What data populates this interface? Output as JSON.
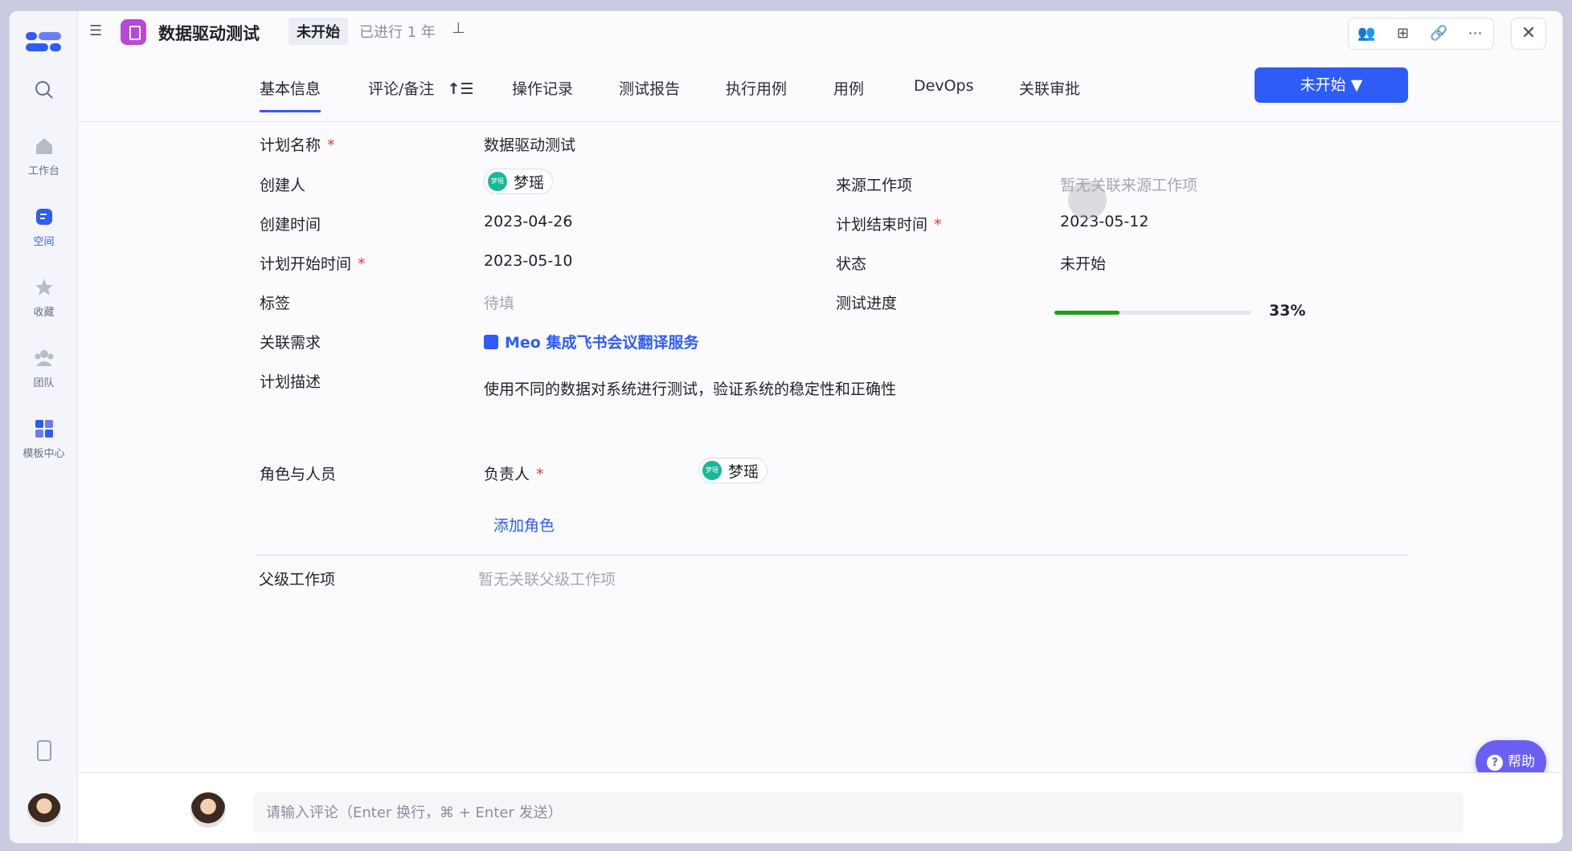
{
  "header": {
    "expand_icon": "sidebar-expand-icon",
    "title": "数据驱动测试",
    "status_badge": "未开始",
    "elapsed": "已进行 1 年",
    "pin_icon": "pin-icon",
    "actions": [
      "members-icon",
      "bookmark-icon",
      "link-icon",
      "more-icon"
    ],
    "close_icon": "close-icon"
  },
  "sidebar": {
    "items": [
      {
        "label": "",
        "icon": "search-icon"
      },
      {
        "label": "工作台",
        "icon": "home-icon"
      },
      {
        "label": "空间",
        "icon": "space-icon",
        "active": true
      },
      {
        "label": "收藏",
        "icon": "star-icon"
      },
      {
        "label": "团队",
        "icon": "team-icon"
      },
      {
        "label": "模板中心",
        "icon": "template-icon"
      }
    ]
  },
  "tabs": [
    {
      "label": "基本信息",
      "active": true
    },
    {
      "label": "评论/备注"
    },
    {
      "label": "操作记录"
    },
    {
      "label": "测试报告"
    },
    {
      "label": "执行用例"
    },
    {
      "label": "用例"
    },
    {
      "label": "DevOps"
    },
    {
      "label": "关联审批"
    }
  ],
  "status_button": {
    "label": "未开始 ▼"
  },
  "fields": {
    "plan_name": {
      "label": "计划名称",
      "value": "数据驱动测试"
    },
    "creator": {
      "label": "创建人",
      "value": "梦瑶",
      "avatar_text": "梦瑶"
    },
    "source_item": {
      "label": "来源工作项",
      "value": "暂无关联来源工作项"
    },
    "created_at": {
      "label": "创建时间",
      "value": "2023-04-26"
    },
    "plan_end": {
      "label": "计划结束时间",
      "value": "2023-05-12"
    },
    "plan_start": {
      "label": "计划开始时间",
      "value": "2023-05-10"
    },
    "status": {
      "label": "状态",
      "value": "未开始"
    },
    "tags": {
      "label": "标签",
      "value": "待填"
    },
    "progress": {
      "label": "测试进度",
      "value": "33%",
      "fraction": 0.33,
      "color": "#16a316"
    },
    "linked_req": {
      "label": "关联需求",
      "value": "Meo 集成飞书会议翻译服务"
    },
    "description": {
      "label": "计划描述",
      "value": "使用不同的数据对系统进行测试，验证系统的稳定性和正确性"
    },
    "roles": {
      "label": "角色与人员",
      "owner_label": "负责人",
      "owner": "梦瑶",
      "owner_avatar": "梦瑶",
      "add_role": "添加角色"
    },
    "parent": {
      "label": "父级工作项",
      "value": "暂无关联父级工作项"
    }
  },
  "help": {
    "label": "帮助"
  },
  "comment": {
    "placeholder": "请输入评论（Enter 换行，⌘ + Enter 发送）"
  },
  "colors": {
    "accent": "#2e5cf6",
    "app_icon": "#b44ad6",
    "help": "#6a5ff5"
  }
}
